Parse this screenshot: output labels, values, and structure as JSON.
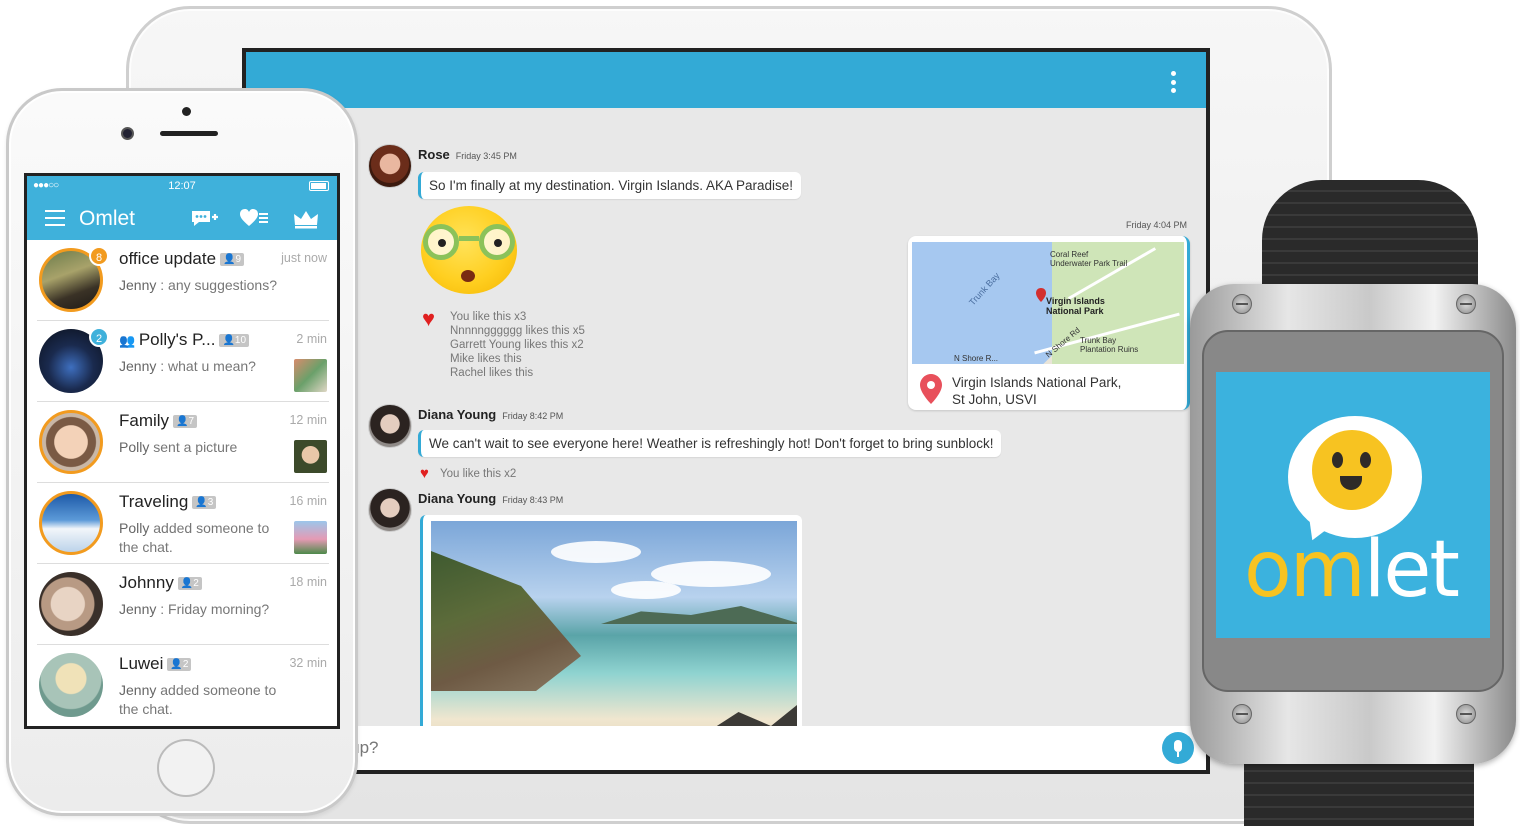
{
  "tablet": {
    "messages": [
      {
        "sender": "Rose",
        "time": "Friday 3:45 PM",
        "text": "So I'm finally at my destination. Virgin Islands. AKA Paradise!"
      },
      {
        "sender": "Diana Young",
        "time": "Friday 8:42 PM",
        "text": "We can't wait to see everyone here! Weather is refreshingly hot! Don't forget to bring sunblock!"
      },
      {
        "sender": "Diana Young",
        "time": "Friday 8:43 PM",
        "text": ""
      }
    ],
    "sticker_likes": [
      "You like this x3",
      "Nnnnngggggg likes this x5",
      "Garrett Young likes this x2",
      "Mike likes this",
      "Rachel likes this"
    ],
    "message2_likes": "You like this x2",
    "location": {
      "time": "Friday 4:04 PM",
      "name_line1": "Virgin Islands National Park,",
      "name_line2": "St John, USVI",
      "map_labels": {
        "trunk_bay": "Trunk Bay",
        "coral_reef_1": "Coral Reef",
        "coral_reef_2": "Underwater Park Trail",
        "park_1": "Virgin Islands",
        "park_2": "National Park",
        "north_shore": "N Shore Rd",
        "north_shore_2": "N Shore R...",
        "plantation_1": "Trunk Bay",
        "plantation_2": "Plantation Ruins"
      }
    },
    "input_placeholder": "What's up?",
    "colors": {
      "appbar": "#33aad6",
      "accent": "#33aad6",
      "heart": "#e02020"
    }
  },
  "phone": {
    "status": {
      "signal": "●●●○○",
      "clock": "12:07"
    },
    "title": "Omlet",
    "header_icons": [
      "new-chat-icon",
      "heart-list-icon",
      "crown-icon"
    ],
    "chats": [
      {
        "name": "office update",
        "count": "9",
        "time": "just now",
        "preview_user": "Jenny",
        "preview": " : any suggestions?",
        "badge": "8",
        "badge_color": "#f29b1f"
      },
      {
        "name": "Polly's P...",
        "count": "10",
        "time": "2 min",
        "preview_user": "Jenny",
        "preview": " : what u mean?",
        "badge": "2",
        "badge_color": "#3fb1db"
      },
      {
        "name": "Family",
        "count": "7",
        "time": "12 min",
        "preview_user": "Polly",
        "preview": " sent a picture",
        "badge": "",
        "badge_color": ""
      },
      {
        "name": "Traveling",
        "count": "3",
        "time": "16 min",
        "preview_user": "Polly",
        "preview": " added someone to the chat.",
        "badge": "",
        "badge_color": ""
      },
      {
        "name": "Johnny",
        "count": "2",
        "time": "18 min",
        "preview_user": "Jenny",
        "preview": " : Friday morning?",
        "badge": "",
        "badge_color": ""
      },
      {
        "name": "Luwei",
        "count": "2",
        "time": "32 min",
        "preview_user": "Jenny",
        "preview": " added someone to the chat.",
        "badge": "",
        "badge_color": ""
      }
    ]
  },
  "watch": {
    "logo_om": "om",
    "logo_let": "let"
  }
}
